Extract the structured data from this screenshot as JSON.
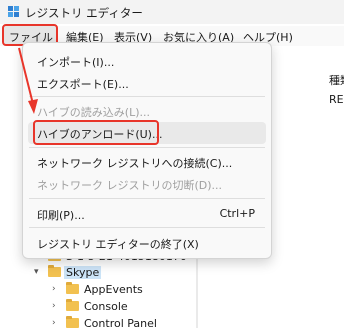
{
  "window": {
    "title": "レジストリ エディター"
  },
  "menubar": {
    "items": [
      "ファイル(F)",
      "編集(E)",
      "表示(V)",
      "お気に入り(A)",
      "ヘルプ(H)"
    ]
  },
  "file_menu": {
    "items": [
      {
        "label": "インポート(I)...",
        "enabled": true
      },
      {
        "label": "エクスポート(E)...",
        "enabled": true
      },
      {
        "label": "ハイブの読み込み(L)...",
        "enabled": false
      },
      {
        "label": "ハイブのアンロード(U)...",
        "enabled": true,
        "highlighted": true
      },
      {
        "label": "ネットワーク レジストリへの接続(C)...",
        "enabled": true
      },
      {
        "label": "ネットワーク レジストリの切断(D)...",
        "enabled": false
      },
      {
        "label": "印刷(P)...",
        "enabled": true,
        "shortcut": "Ctrl+P"
      },
      {
        "label": "レジストリ エディターの終了(X)",
        "enabled": true
      }
    ]
  },
  "list_pane": {
    "column_header": "種類",
    "first_value": "REG"
  },
  "tree": {
    "partial_key": "S-1-5-21-4015180170",
    "selected": "Skype",
    "children": [
      "AppEvents",
      "Console",
      "Control Panel"
    ]
  },
  "colors": {
    "highlight_border": "#e8352a",
    "folder": "#f2c150",
    "selection": "#cce4f7"
  }
}
